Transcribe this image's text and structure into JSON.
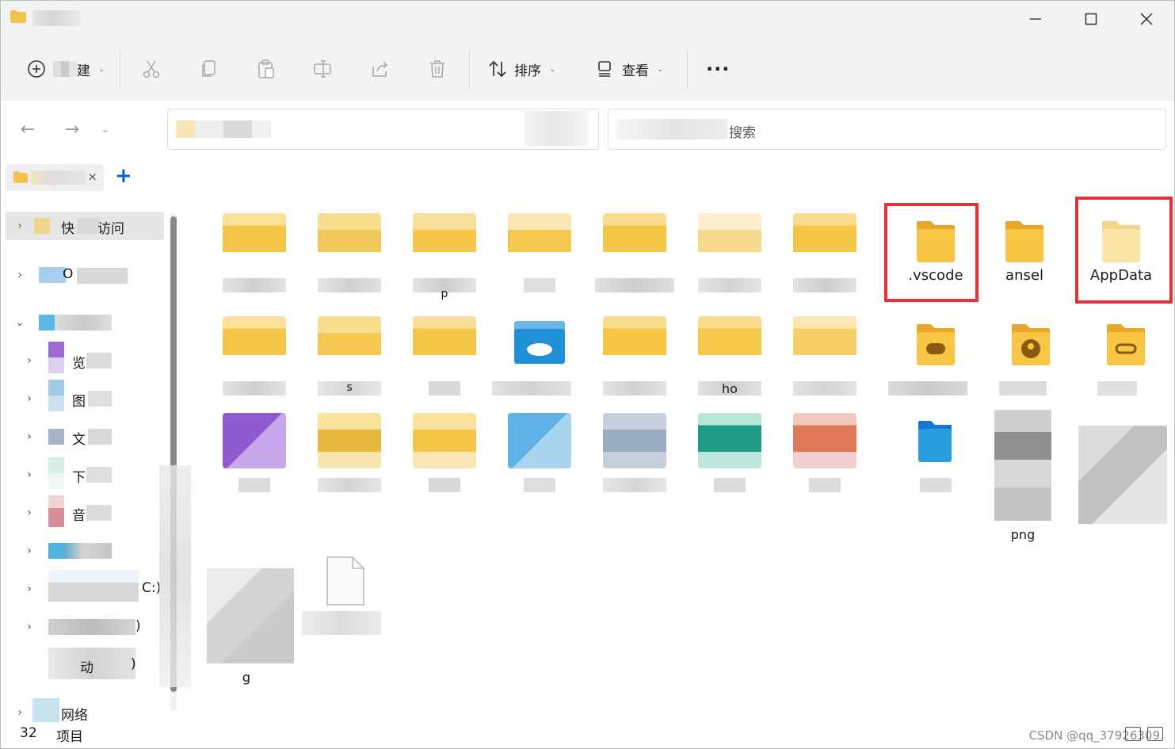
{
  "window": {
    "title": "",
    "controls": {
      "minimize": "─",
      "maximize": "☐",
      "close": "✕"
    }
  },
  "toolbar": {
    "new_label": "建",
    "sort_label": "排序",
    "view_label": "查看",
    "more_label": "···"
  },
  "search": {
    "placeholder": "搜索"
  },
  "tab": {
    "close": "×",
    "add": "+"
  },
  "sidebar": {
    "items": [
      {
        "label": "快",
        "label2": "访问"
      },
      {
        "label": "O"
      },
      {
        "label": ""
      },
      {
        "label": "览"
      },
      {
        "label": "图"
      },
      {
        "label": "文"
      },
      {
        "label": "下"
      },
      {
        "label": "音"
      },
      {
        "label": ""
      },
      {
        "label": "C:)"
      },
      {
        "label": ")"
      },
      {
        "label": "动",
        "label2": ")"
      },
      {
        "label": "网络"
      }
    ]
  },
  "content": {
    "items": [
      {
        "name": "",
        "kind": "folder"
      },
      {
        "name": "",
        "kind": "folder"
      },
      {
        "name": "p",
        "kind": "folder"
      },
      {
        "name": "",
        "kind": "folder"
      },
      {
        "name": "",
        "kind": "folder"
      },
      {
        "name": "",
        "kind": "folder"
      },
      {
        "name": "",
        "kind": "folder"
      },
      {
        "name": ".vscode",
        "kind": "folder"
      },
      {
        "name": "ansel",
        "kind": "folder"
      },
      {
        "name": "AppData",
        "kind": "folder"
      },
      {
        "name": "",
        "kind": "folder"
      },
      {
        "name": "s",
        "kind": "folder"
      },
      {
        "name": "",
        "kind": "folder"
      },
      {
        "name": "",
        "kind": "cloud-folder"
      },
      {
        "name": "",
        "kind": "folder"
      },
      {
        "name": "ho",
        "kind": "folder"
      },
      {
        "name": "",
        "kind": "folder"
      },
      {
        "name": "",
        "kind": "games-folder"
      },
      {
        "name": "",
        "kind": "contacts-folder"
      },
      {
        "name": "",
        "kind": "links-folder"
      },
      {
        "name": "",
        "kind": "purple-folder"
      },
      {
        "name": "",
        "kind": "folder"
      },
      {
        "name": "",
        "kind": "folder"
      },
      {
        "name": "",
        "kind": "blue-folder"
      },
      {
        "name": "",
        "kind": "folder"
      },
      {
        "name": "",
        "kind": "teal-folder"
      },
      {
        "name": "",
        "kind": "orange-folder"
      },
      {
        "name": "",
        "kind": "blue-folder"
      },
      {
        "name": "png",
        "kind": "image-file"
      },
      {
        "name": "",
        "kind": "image-file"
      },
      {
        "name": "g",
        "kind": "image-file"
      },
      {
        "name": "",
        "kind": "file"
      }
    ]
  },
  "status": {
    "count": "32",
    "unit": "项目",
    "watermark": "CSDN @qq_37926309"
  },
  "colors": {
    "highlight": "#e8303a",
    "folder": "#f8c644",
    "accent": "#0a61d1"
  }
}
